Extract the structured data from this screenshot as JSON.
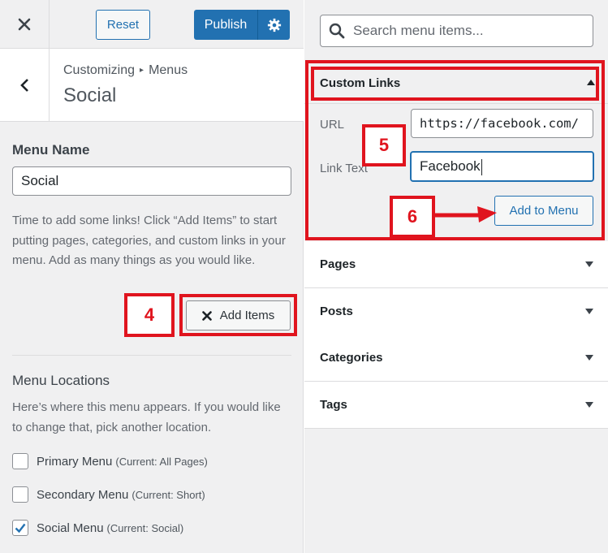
{
  "topbar": {
    "close_icon": "close-icon",
    "reset_label": "Reset",
    "publish_label": "Publish",
    "gear_icon": "gear-icon"
  },
  "breadcrumb": {
    "parent": "Customizing",
    "separator": "▸",
    "current": "Menus",
    "section_title": "Social",
    "back_icon": "chevron-left-icon"
  },
  "menu_name": {
    "label": "Menu Name",
    "value": "Social",
    "help": "Time to add some links! Click “Add Items” to start putting pages, categories, and custom links in your menu. Add as many things as you would like."
  },
  "add_items": {
    "label": "Add Items",
    "icon": "close-icon"
  },
  "menu_locations": {
    "title": "Menu Locations",
    "help": "Here’s where this menu appears. If you would like to change that, pick another location.",
    "items": [
      {
        "label": "Primary Menu",
        "current": "(Current: All Pages)",
        "checked": false
      },
      {
        "label": "Secondary Menu",
        "current": "(Current: Short)",
        "checked": false
      },
      {
        "label": "Social Menu",
        "current": "(Current: Social)",
        "checked": true
      }
    ]
  },
  "search": {
    "placeholder": "Search menu items...",
    "icon": "search-icon"
  },
  "custom_links": {
    "title": "Custom Links",
    "url_label": "URL",
    "url_value": "https://facebook.com/",
    "link_text_label": "Link Text",
    "link_text_value": "Facebook",
    "add_button": "Add to Menu"
  },
  "accordion": [
    {
      "label": "Pages"
    },
    {
      "label": "Posts"
    },
    {
      "label": "Categories"
    },
    {
      "label": "Tags"
    }
  ],
  "annotations": {
    "step4": "4",
    "step5": "5",
    "step6": "6"
  },
  "colors": {
    "accent": "#2271b1",
    "annotation_red": "#e0141e"
  }
}
